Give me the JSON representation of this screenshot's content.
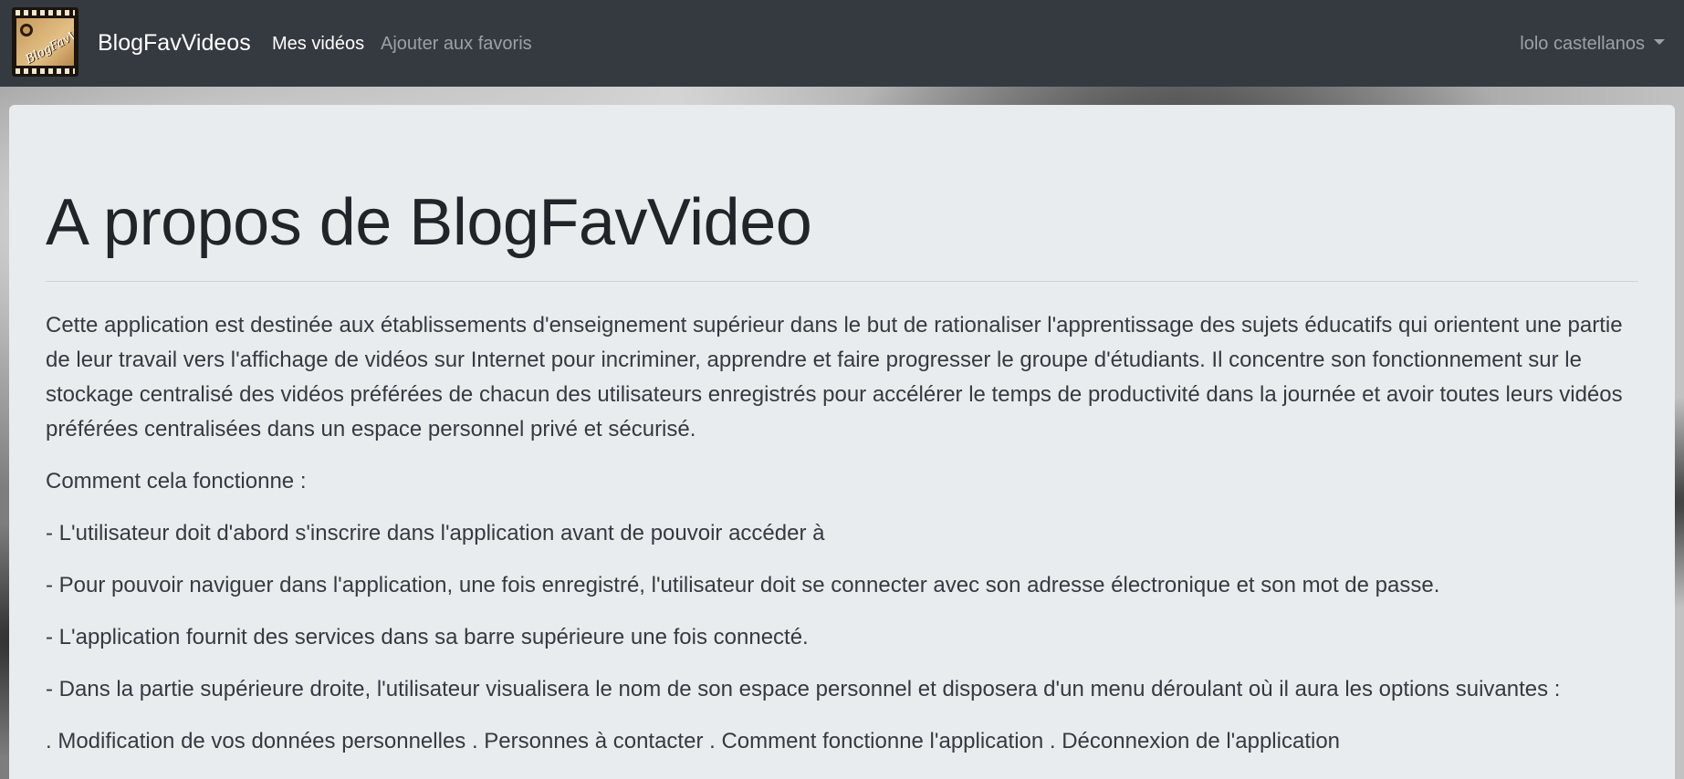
{
  "navbar": {
    "brand_name": "BlogFavVideos",
    "logo_text": "BlogFavVideo",
    "links": [
      {
        "label": "Mes vidéos",
        "active": true
      },
      {
        "label": "Ajouter aux favoris",
        "active": false
      }
    ],
    "user_name": "lolo castellanos"
  },
  "main": {
    "title": "A propos de BlogFavVideo",
    "paragraphs": [
      "Cette application est destinée aux établissements d'enseignement supérieur dans le but de rationaliser l'apprentissage des sujets éducatifs qui orientent une partie de leur travail vers l'affichage de vidéos sur Internet pour incriminer, apprendre et faire progresser le groupe d'étudiants. Il concentre son fonctionnement sur le stockage centralisé des vidéos préférées de chacun des utilisateurs enregistrés pour accélérer le temps de productivité dans la journée et avoir toutes leurs vidéos préférées centralisées dans un espace personnel privé et sécurisé.",
      "Comment cela fonctionne :",
      "- L'utilisateur doit d'abord s'inscrire dans l'application avant de pouvoir accéder à",
      "- Pour pouvoir naviguer dans l'application, une fois enregistré, l'utilisateur doit se connecter avec son adresse électronique et son mot de passe.",
      "- L'application fournit des services dans sa barre supérieure une fois connecté.",
      "- Dans la partie supérieure droite, l'utilisateur visualisera le nom de son espace personnel et disposera d'un menu déroulant où il aura les options suivantes :",
      ". Modification de vos données personnelles . Personnes à contacter . Comment fonctionne l'application . Déconnexion de l'application"
    ]
  },
  "colors": {
    "navbar_bg": "#343a40",
    "jumbotron_bg": "#e9ecef",
    "text": "#343a40",
    "nav_muted": "#9ba1a6"
  }
}
